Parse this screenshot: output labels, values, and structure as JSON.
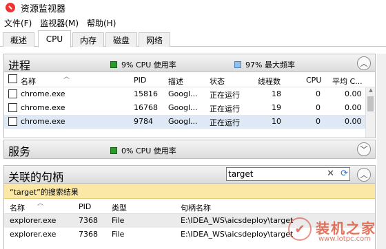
{
  "window": {
    "title": "资源监视器"
  },
  "menu": [
    "文件(F)",
    "监视器(M)",
    "帮助(H)"
  ],
  "tabs": [
    {
      "label": "概述",
      "active": false
    },
    {
      "label": "CPU",
      "active": true
    },
    {
      "label": "内存",
      "active": false
    },
    {
      "label": "磁盘",
      "active": false
    },
    {
      "label": "网络",
      "active": false
    }
  ],
  "processes": {
    "title": "进程",
    "cpu_usage": "9% CPU 使用率",
    "max_freq": "97% 最大频率",
    "columns": [
      "名称",
      "PID",
      "描述",
      "状态",
      "线程数",
      "CPU",
      "平均 C..."
    ],
    "rows": [
      {
        "name": "chrome.exe",
        "pid": "15816",
        "desc": "Googl...",
        "status": "正在运行",
        "threads": "18",
        "cpu": "0",
        "avg": "0.00",
        "selected": false
      },
      {
        "name": "chrome.exe",
        "pid": "16768",
        "desc": "Googl...",
        "status": "正在运行",
        "threads": "19",
        "cpu": "0",
        "avg": "0.00",
        "selected": false
      },
      {
        "name": "chrome.exe",
        "pid": "9784",
        "desc": "Googl...",
        "status": "正在运行",
        "threads": "10",
        "cpu": "0",
        "avg": "0.00",
        "selected": true
      }
    ]
  },
  "services": {
    "title": "服务",
    "cpu_usage": "0% CPU 使用率"
  },
  "handles": {
    "title": "关联的句柄",
    "search_value": "target",
    "results_label": "“target”的搜索结果",
    "columns": [
      "名称",
      "PID",
      "类型",
      "句柄名称"
    ],
    "rows": [
      {
        "name": "explorer.exe",
        "pid": "7368",
        "type": "File",
        "handle": "E:\\IDEA_WS\\aicsdeploy\\target"
      },
      {
        "name": "explorer.exe",
        "pid": "7368",
        "type": "File",
        "handle": "E:\\IDEA_WS\\aicsdeploy\\target"
      }
    ]
  },
  "watermark": {
    "text": "装机之家",
    "url": "www.lotpc.com"
  },
  "colors": {
    "accent_green": "#2c9a2c",
    "accent_blue": "#8fc0ee",
    "results_bg": "#fbe8a6",
    "selected_row": "#dfe9f6"
  },
  "icons": [
    "resource-monitor-icon",
    "collapse-up-icon",
    "expand-down-icon",
    "clear-icon",
    "refresh-icon",
    "checkbox-icon"
  ]
}
